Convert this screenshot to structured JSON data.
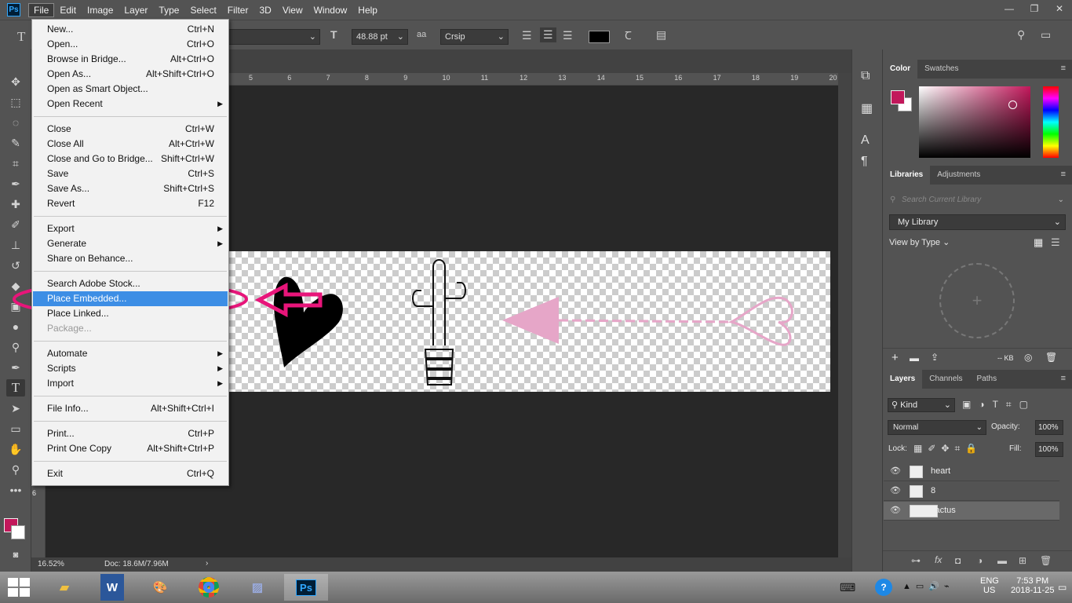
{
  "app": {
    "logo": "Ps"
  },
  "menubar": [
    "File",
    "Edit",
    "Image",
    "Layer",
    "Type",
    "Select",
    "Filter",
    "3D",
    "View",
    "Window",
    "Help"
  ],
  "window_controls": [
    "—",
    "❐",
    "✕"
  ],
  "options": {
    "font_size": "48.88 pt",
    "aa_label": "aa",
    "antialias": "Crsip"
  },
  "ruler_h": [
    "5",
    "6",
    "7",
    "8",
    "9",
    "10",
    "11",
    "12",
    "13",
    "14",
    "15",
    "16",
    "17",
    "18",
    "19",
    "20"
  ],
  "ruler_v_marker": "6",
  "status": {
    "zoom": "16.52%",
    "doc": "Doc: 18.6M/7.96M"
  },
  "file_menu": {
    "items": [
      {
        "label": "New...",
        "shortcut": "Ctrl+N"
      },
      {
        "label": "Open...",
        "shortcut": "Ctrl+O"
      },
      {
        "label": "Browse in Bridge...",
        "shortcut": "Alt+Ctrl+O"
      },
      {
        "label": "Open As...",
        "shortcut": "Alt+Shift+Ctrl+O"
      },
      {
        "label": "Open as Smart Object...",
        "shortcut": ""
      },
      {
        "label": "Open Recent",
        "shortcut": "",
        "submenu": true
      },
      {
        "label": "Close",
        "shortcut": "Ctrl+W"
      },
      {
        "label": "Close All",
        "shortcut": "Alt+Ctrl+W"
      },
      {
        "label": "Close and Go to Bridge...",
        "shortcut": "Shift+Ctrl+W"
      },
      {
        "label": "Save",
        "shortcut": "Ctrl+S"
      },
      {
        "label": "Save As...",
        "shortcut": "Shift+Ctrl+S"
      },
      {
        "label": "Revert",
        "shortcut": "F12"
      },
      {
        "label": "Export",
        "shortcut": "",
        "submenu": true
      },
      {
        "label": "Generate",
        "shortcut": "",
        "submenu": true
      },
      {
        "label": "Share on Behance...",
        "shortcut": ""
      },
      {
        "label": "Search Adobe Stock...",
        "shortcut": ""
      },
      {
        "label": "Place Embedded...",
        "shortcut": "",
        "highlighted": true
      },
      {
        "label": "Place Linked...",
        "shortcut": ""
      },
      {
        "label": "Package...",
        "shortcut": "",
        "disabled": true
      },
      {
        "label": "Automate",
        "shortcut": "",
        "submenu": true
      },
      {
        "label": "Scripts",
        "shortcut": "",
        "submenu": true
      },
      {
        "label": "Import",
        "shortcut": "",
        "submenu": true
      },
      {
        "label": "File Info...",
        "shortcut": "Alt+Shift+Ctrl+I"
      },
      {
        "label": "Print...",
        "shortcut": "Ctrl+P"
      },
      {
        "label": "Print One Copy",
        "shortcut": "Alt+Shift+Ctrl+P"
      },
      {
        "label": "Exit",
        "shortcut": "Ctrl+Q"
      }
    ]
  },
  "color_panel": {
    "tabs": [
      "Color",
      "Swatches"
    ],
    "foreground": "#c2185b"
  },
  "libraries_panel": {
    "tabs": [
      "Libraries",
      "Adjustments"
    ],
    "search_placeholder": "Search Current Library",
    "library": "My Library",
    "view_by": "View by Type",
    "size_label": "-- KB"
  },
  "layers_panel": {
    "tabs": [
      "Layers",
      "Channels",
      "Paths"
    ],
    "kind": "Kind",
    "blend_mode": "Normal",
    "opacity_label": "Opacity:",
    "opacity": "100%",
    "lock_label": "Lock:",
    "fill_label": "Fill:",
    "fill": "100%",
    "layers": [
      {
        "name": "heart"
      },
      {
        "name": "8"
      },
      {
        "name": "cactus",
        "selected": true
      }
    ]
  },
  "taskbar": {
    "apps": [
      "Explorer",
      "W",
      "Paint",
      "Chrome",
      "Photos",
      "Ps"
    ],
    "lang1": "ENG",
    "lang2": "US",
    "time": "7:53 PM",
    "date": "2018-11-25"
  },
  "annotation": {
    "color": "#e8157a",
    "arrow_color": "#e8157a"
  }
}
